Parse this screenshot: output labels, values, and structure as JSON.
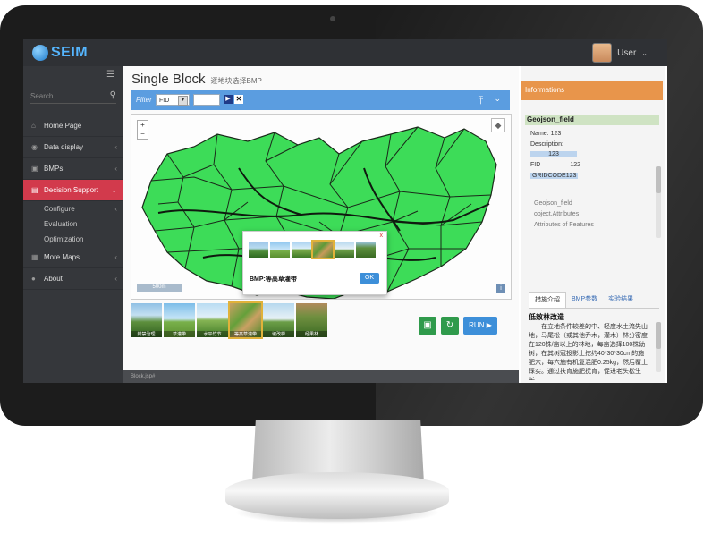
{
  "app": {
    "name": "SEIM"
  },
  "user": {
    "name": "User"
  },
  "sidebar": {
    "search_placeholder": "Search",
    "items": [
      {
        "label": "Home Page"
      },
      {
        "label": "Data display"
      },
      {
        "label": "BMPs"
      },
      {
        "label": "Decision Support"
      },
      {
        "label": "More Maps"
      },
      {
        "label": "About"
      }
    ],
    "subitems": [
      {
        "label": "Configure"
      },
      {
        "label": "Evaluation"
      },
      {
        "label": "Optimization"
      }
    ]
  },
  "main": {
    "title": "Single Block",
    "subtitle": "逐地块选择BMP",
    "filter_label": "Filter",
    "filter_field": "FID",
    "scale_label": "500m",
    "popup_bmp_label": "BMP:",
    "popup_bmp_value": "等高草灌带",
    "popup_ok": "OK",
    "run_label": "RUN",
    "status_link": "Block.jsp#",
    "strip_labels": [
      "封禁治理",
      "草灌带",
      "水平竹节",
      "等高草灌带",
      "坡改梯",
      "经果林"
    ]
  },
  "right_panel": {
    "header": "Informations",
    "field_title": "Geojson_field",
    "name_label": "Name:",
    "name_value": "123",
    "desc_label": "Description:",
    "desc_value": "123",
    "fid_label": "FID",
    "fid_value": "122",
    "gridcode": "GRIDCODE123",
    "desc_lines": [
      "Geojson_field",
      "object.Attributes",
      "Attributes of Features"
    ],
    "tabs": [
      {
        "label": "措施介绍"
      },
      {
        "label": "BMP参数"
      },
      {
        "label": "实验结果"
      }
    ],
    "article_title": "低效林改造",
    "article_text": "在立地条件较差的中、轻度水土流失山地，马尾松（或其他乔木，灌木）林分密度在120株/亩以上的林地，每亩选择100株幼树，在其树冠投影上挖约40*30*30cm的施肥穴，每穴施有机复混肥0.25kg，然后覆土踩实。通过扶育施肥抚育，促进老头松生长。"
  },
  "colors": {
    "accent_red": "#d23a4c",
    "filter_blue": "#5b9de0",
    "info_orange": "#e8954b",
    "map_green": "#3ddc58",
    "run_blue": "#3d8fd9",
    "action_green": "#2f9a4b"
  },
  "icons": [
    "globe-icon",
    "search-icon",
    "home-icon",
    "chart-icon",
    "bmp-icon",
    "decision-icon",
    "map-icon",
    "comment-icon",
    "upload-icon",
    "layers-icon",
    "save-icon",
    "refresh-icon"
  ]
}
